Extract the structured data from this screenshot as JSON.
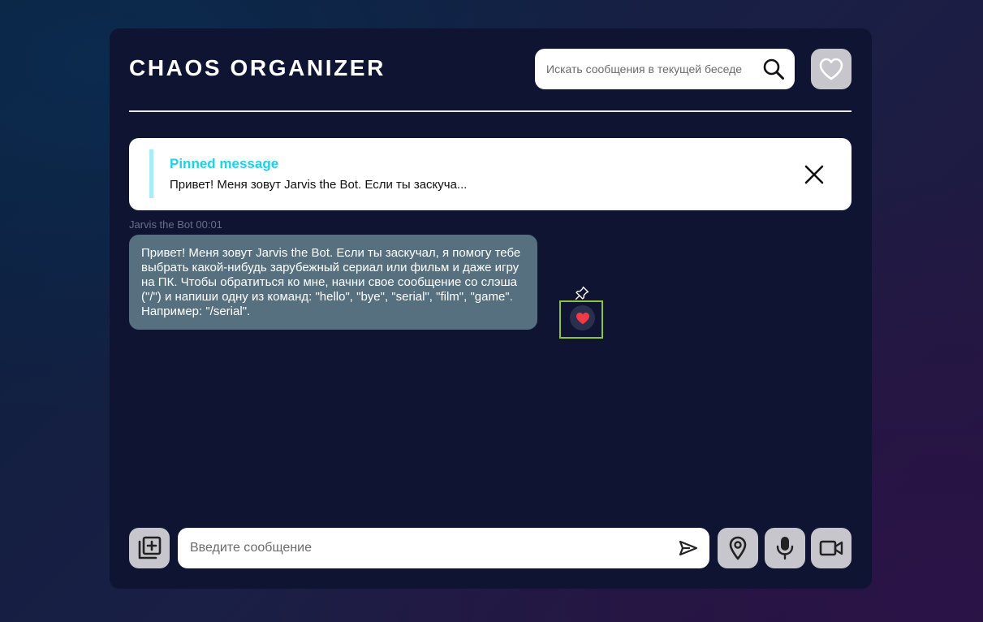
{
  "header": {
    "title": "CHAOS ORGANIZER",
    "search_placeholder": "Искать сообщения в текущей беседе",
    "search_icon": "search-icon",
    "favorites_icon": "heart-outline-icon"
  },
  "pinned": {
    "title": "Pinned message",
    "text": "Привет! Меня зовут Jarvis the Bot. Если ты заскуча...",
    "close_icon": "close-icon"
  },
  "messages": [
    {
      "author": "Jarvis the Bot",
      "time": "00:01",
      "meta": "Jarvis the Bot 00:01",
      "text": "Привет! Меня зовут Jarvis the Bot. Если ты заскучал, я помогу тебе выбрать какой-нибудь зарубежный сериал или фильм и даже игру на ПК. Чтобы обратиться ко мне, начни свое сообщение со слэша (\"/\") и напиши одну из команд: \"hello\", \"bye\", \"serial\", \"film\", \"game\". Например: \"/serial\".",
      "liked": true,
      "actions": [
        "pin-icon",
        "heart-filled-icon"
      ]
    }
  ],
  "composer": {
    "placeholder": "Введите сообщение",
    "attach_icon": "add-file-icon",
    "send_icon": "send-icon",
    "location_icon": "location-pin-icon",
    "microphone_icon": "microphone-icon",
    "video_icon": "video-camera-icon"
  },
  "colors": {
    "accent": "#1fd0ea",
    "bubble": "#56707f",
    "like": "#f23a46",
    "highlight": "#8fc33a",
    "panel": "#0f1433"
  }
}
